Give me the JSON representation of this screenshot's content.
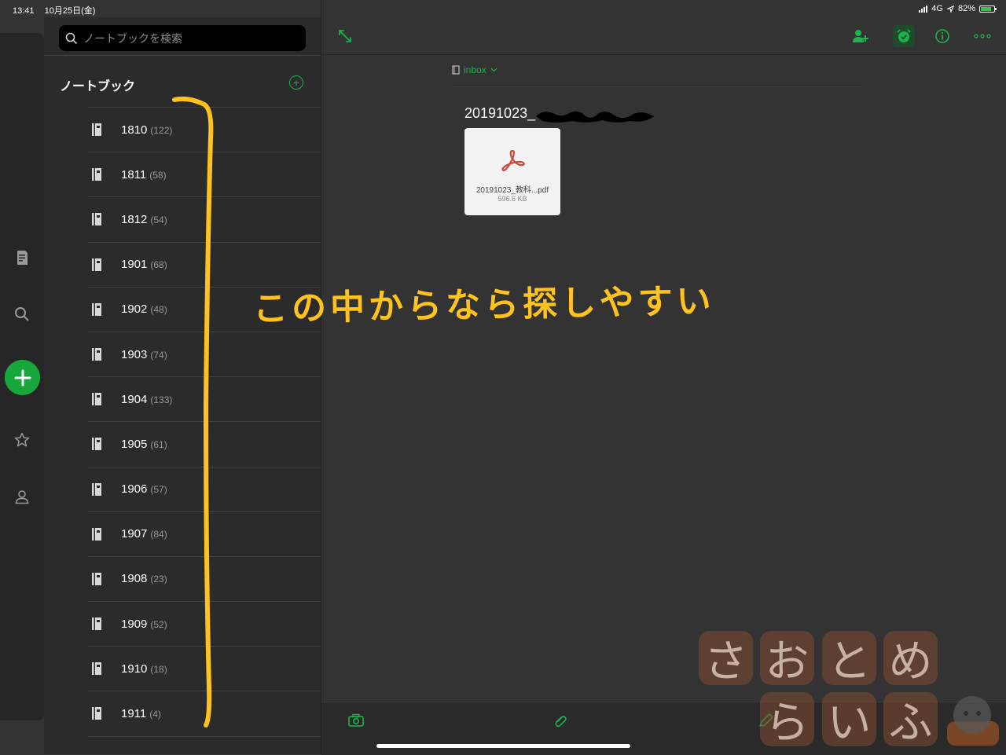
{
  "status_bar": {
    "time": "13:41",
    "date": "10月25日(金)",
    "network": "4G",
    "battery": "82%",
    "battery_level": 0.82
  },
  "sidebar_rail": {
    "icons": [
      "notes-icon",
      "search-icon",
      "new-note-icon",
      "star-icon",
      "account-icon"
    ]
  },
  "notebook_panel": {
    "search": {
      "placeholder": "ノートブックを検索"
    },
    "title": "ノートブック",
    "notebooks": [
      {
        "name": "1810",
        "count": "(122)"
      },
      {
        "name": "1811",
        "count": "(58)"
      },
      {
        "name": "1812",
        "count": "(54)"
      },
      {
        "name": "1901",
        "count": "(68)"
      },
      {
        "name": "1902",
        "count": "(48)"
      },
      {
        "name": "1903",
        "count": "(74)"
      },
      {
        "name": "1904",
        "count": "(133)"
      },
      {
        "name": "1905",
        "count": "(61)"
      },
      {
        "name": "1906",
        "count": "(57)"
      },
      {
        "name": "1907",
        "count": "(84)"
      },
      {
        "name": "1908",
        "count": "(23)"
      },
      {
        "name": "1909",
        "count": "(52)"
      },
      {
        "name": "1910",
        "count": "(18)"
      },
      {
        "name": "1911",
        "count": "(4)"
      }
    ]
  },
  "note": {
    "notebook": "inbox",
    "title": "20191023_",
    "attachment": {
      "name": "20191023_教科...pdf",
      "size": "596.6 KB"
    }
  },
  "overlay": {
    "caption": "この中からなら探しやすい"
  },
  "watermark": {
    "chars": [
      "さ",
      "お",
      "と",
      "め",
      "ら",
      "い",
      "ふ"
    ]
  },
  "colors": {
    "accent": "#1db24c",
    "highlight_yellow": "#ffc21e"
  }
}
